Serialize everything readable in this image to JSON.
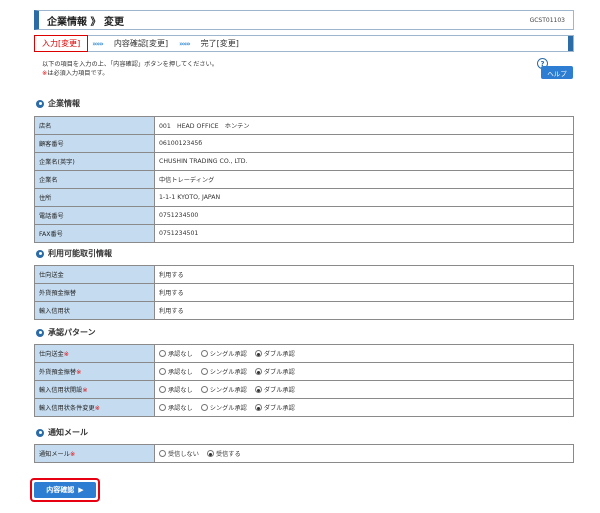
{
  "header": {
    "title": "企業情報 》 変更",
    "screen_code": "GCST01103"
  },
  "steps": [
    {
      "label": "入力[変更]",
      "active": true
    },
    {
      "label": "内容確認[変更]",
      "active": false
    },
    {
      "label": "完了[変更]",
      "active": false
    }
  ],
  "step_separator": "»»»",
  "intro": {
    "line1": "以下の項目を入力の上、「内容確認」ボタンを押してください。",
    "req_mark": "※",
    "line2": "は必須入力項目です。"
  },
  "help": {
    "q": "?",
    "label": "ヘルプ"
  },
  "sections": {
    "company": {
      "title": "企業情報"
    },
    "services": {
      "title": "利用可能取引情報"
    },
    "approval": {
      "title": "承認パターン"
    },
    "notify": {
      "title": "通知メール"
    }
  },
  "company_rows": [
    {
      "label": "店名",
      "value": "001　HEAD OFFICE　ホンテン"
    },
    {
      "label": "顧客番号",
      "value": "0610012345б"
    },
    {
      "label": "企業名(英字)",
      "value": "CHUSHIN TRADING CO., LTD."
    },
    {
      "label": "企業名",
      "value": "中信トレーディング"
    },
    {
      "label": "住所",
      "value": "1-1-1 KYOTO, JAPAN"
    },
    {
      "label": "電話番号",
      "value": "0751234500"
    },
    {
      "label": "FAX番号",
      "value": "0751234501"
    }
  ],
  "service_rows": [
    {
      "label": "仕向送金",
      "value": "利用する"
    },
    {
      "label": "外貨預金振替",
      "value": "利用する"
    },
    {
      "label": "輸入信用状",
      "value": "利用する"
    }
  ],
  "radio_options": {
    "none": "承認なし",
    "single": "シングル承認",
    "double": "ダブル承認"
  },
  "approval_rows": [
    {
      "label": "仕向送金",
      "req": "※",
      "selected": "double"
    },
    {
      "label": "外貨預金振替",
      "req": "※",
      "selected": "double"
    },
    {
      "label": "輸入信用状開設",
      "req": "※",
      "selected": "double"
    },
    {
      "label": "輸入信用状条件変更",
      "req": "※",
      "selected": "double"
    }
  ],
  "notify_row": {
    "label": "通知メール",
    "req": "※",
    "options": [
      "受信しない",
      "受信する"
    ],
    "selected_index": 1
  },
  "confirm": {
    "label": "内容確認",
    "arrow": "▶"
  }
}
